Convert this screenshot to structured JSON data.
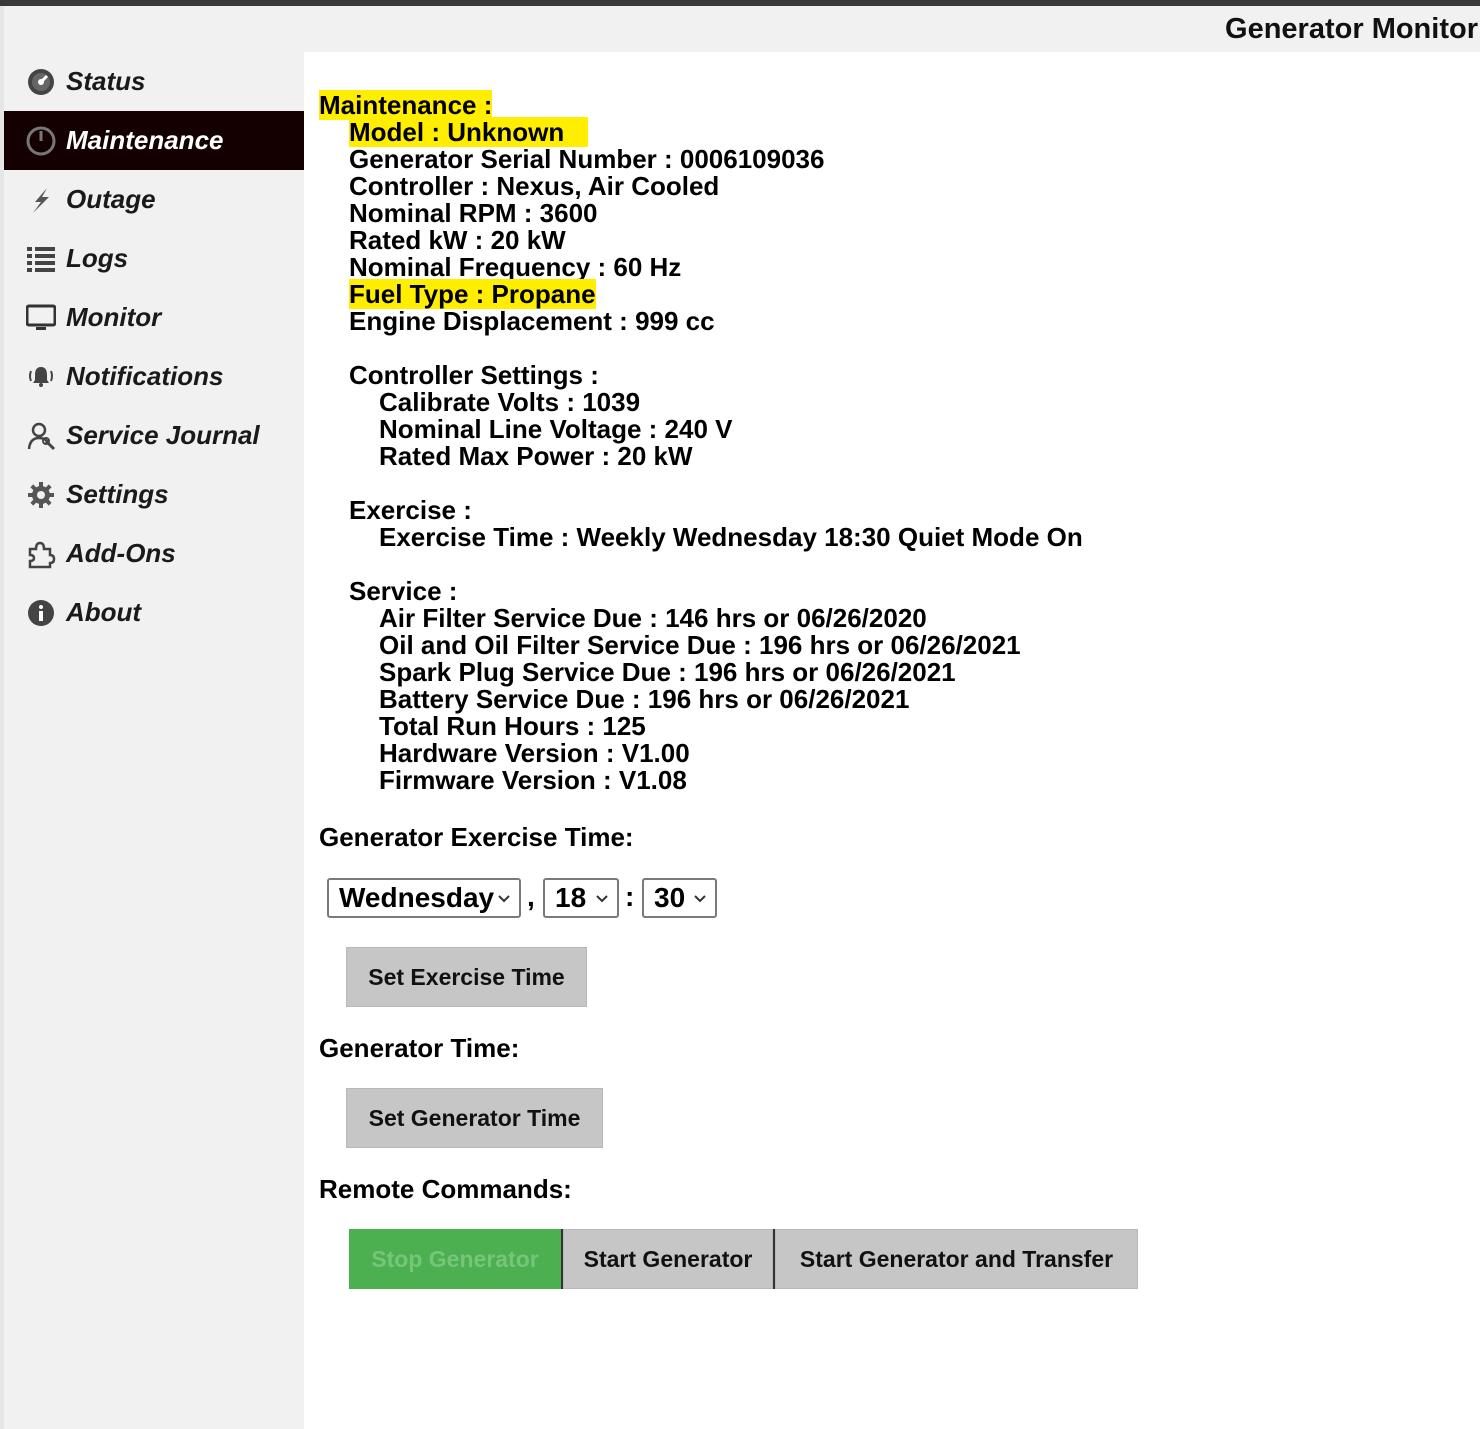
{
  "app_title": "Generator Monitor",
  "nav": [
    {
      "label": "Status",
      "icon": "gauge-icon",
      "active": false
    },
    {
      "label": "Maintenance",
      "icon": "power-icon",
      "active": true
    },
    {
      "label": "Outage",
      "icon": "lightning-icon",
      "active": false
    },
    {
      "label": "Logs",
      "icon": "list-icon",
      "active": false
    },
    {
      "label": "Monitor",
      "icon": "monitor-icon",
      "active": false
    },
    {
      "label": "Notifications",
      "icon": "bell-icon",
      "active": false
    },
    {
      "label": "Service Journal",
      "icon": "mechanic-icon",
      "active": false
    },
    {
      "label": "Settings",
      "icon": "gear-icon",
      "active": false
    },
    {
      "label": "Add-Ons",
      "icon": "puzzle-icon",
      "active": false
    },
    {
      "label": "About",
      "icon": "info-icon",
      "active": false
    }
  ],
  "maintenance": {
    "heading": "Maintenance :",
    "model": "Model : Unknown",
    "serial": "Generator Serial Number : 0006109036",
    "controller": "Controller : Nexus, Air Cooled",
    "rpm": "Nominal RPM : 3600",
    "rated_kw": "Rated kW : 20 kW",
    "frequency": "Nominal Frequency : 60 Hz",
    "fuel": "Fuel Type : Propane",
    "displacement": "Engine Displacement : 999 cc",
    "controller_settings": {
      "heading": "Controller Settings :",
      "calibrate_volts": "Calibrate Volts : 1039",
      "line_voltage": "Nominal Line Voltage : 240 V",
      "max_power": "Rated Max Power : 20 kW"
    },
    "exercise": {
      "heading": "Exercise :",
      "time": "Exercise Time : Weekly Wednesday 18:30 Quiet Mode On"
    },
    "service": {
      "heading": "Service :",
      "air_filter": "Air Filter Service Due : 146 hrs or 06/26/2020",
      "oil": "Oil and Oil Filter Service Due : 196 hrs or 06/26/2021",
      "spark_plug": "Spark Plug Service Due : 196 hrs or 06/26/2021",
      "battery": "Battery Service Due : 196 hrs or 06/26/2021",
      "run_hours": "Total Run Hours : 125",
      "hardware": "Hardware Version : V1.00",
      "firmware": "Firmware Version : V1.08"
    }
  },
  "exercise_time_form": {
    "heading": "Generator Exercise Time:",
    "day": "Wednesday",
    "comma": ",",
    "hour": "18",
    "colon": ":",
    "minute": "30",
    "button": "Set Exercise Time"
  },
  "generator_time": {
    "heading": "Generator Time:",
    "button": "Set Generator Time"
  },
  "remote_commands": {
    "heading": "Remote Commands:",
    "stop": "Stop Generator",
    "start": "Start Generator",
    "start_transfer": "Start Generator and Transfer"
  },
  "colors": {
    "active_nav_bg": "#140000",
    "highlight": "#ffee00",
    "stop_button": "#4caf50",
    "button_gray": "#c6c6c6"
  }
}
